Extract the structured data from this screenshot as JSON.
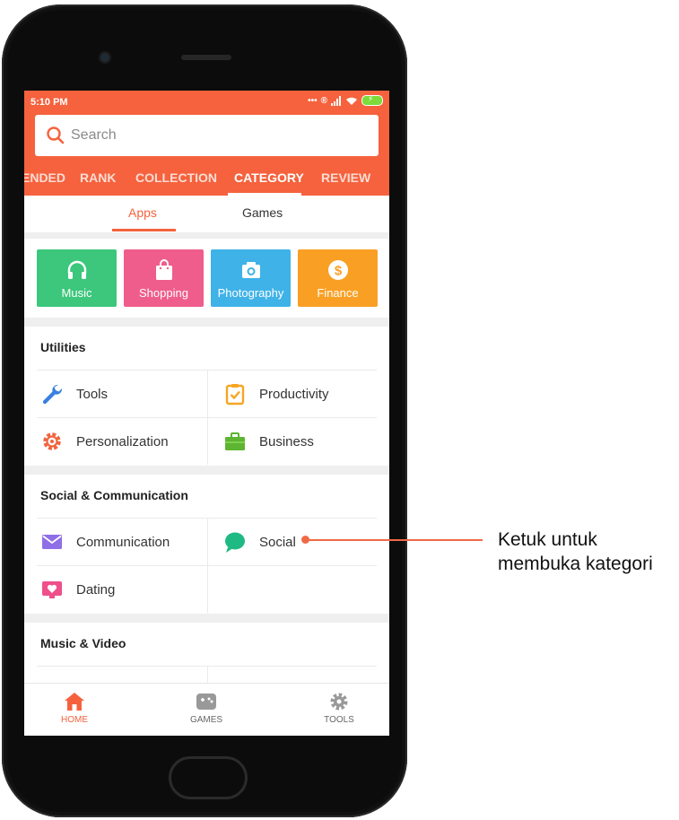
{
  "status_bar": {
    "time": "5:10 PM",
    "icons": [
      "dots-icon",
      "registered-icon",
      "signal-icon",
      "wifi-icon",
      "battery-icon"
    ]
  },
  "search": {
    "placeholder": "Search"
  },
  "top_tabs": [
    {
      "label": "ENDED"
    },
    {
      "label": "RANK"
    },
    {
      "label": "COLLECTION"
    },
    {
      "label": "CATEGORY",
      "active": true
    },
    {
      "label": "REVIEW"
    }
  ],
  "sub_tabs": [
    {
      "label": "Apps",
      "active": true
    },
    {
      "label": "Games"
    }
  ],
  "featured": [
    {
      "label": "Music",
      "color": "#3cc77c",
      "icon": "headphones-icon"
    },
    {
      "label": "Shopping",
      "color": "#ef5d8c",
      "icon": "shopping-bag-icon"
    },
    {
      "label": "Photography",
      "color": "#3fb2e8",
      "icon": "camera-icon"
    },
    {
      "label": "Finance",
      "color": "#f9a024",
      "icon": "dollar-icon"
    }
  ],
  "sections": {
    "utilities": {
      "title": "Utilities",
      "items": [
        {
          "label": "Tools",
          "icon": "wrench-icon"
        },
        {
          "label": "Productivity",
          "icon": "clipboard-check-icon"
        },
        {
          "label": "Personalization",
          "icon": "gear-palette-icon"
        },
        {
          "label": "Business",
          "icon": "briefcase-icon"
        }
      ]
    },
    "social": {
      "title": "Social & Communication",
      "items": [
        {
          "label": "Communication",
          "icon": "envelope-icon"
        },
        {
          "label": "Social",
          "icon": "chat-bubble-icon"
        },
        {
          "label": "Dating",
          "icon": "heart-screen-icon"
        }
      ]
    },
    "music_video": {
      "title": "Music & Video"
    }
  },
  "bottom_nav": [
    {
      "label": "HOME",
      "icon": "home-icon",
      "active": true
    },
    {
      "label": "GAMES",
      "icon": "gamepad-icon"
    },
    {
      "label": "TOOLS",
      "icon": "gear-icon"
    }
  ],
  "callout": {
    "line1": "Ketuk untuk",
    "line2": "membuka kategori"
  },
  "colors": {
    "accent": "#f5623d",
    "callout": "#f06a45"
  }
}
